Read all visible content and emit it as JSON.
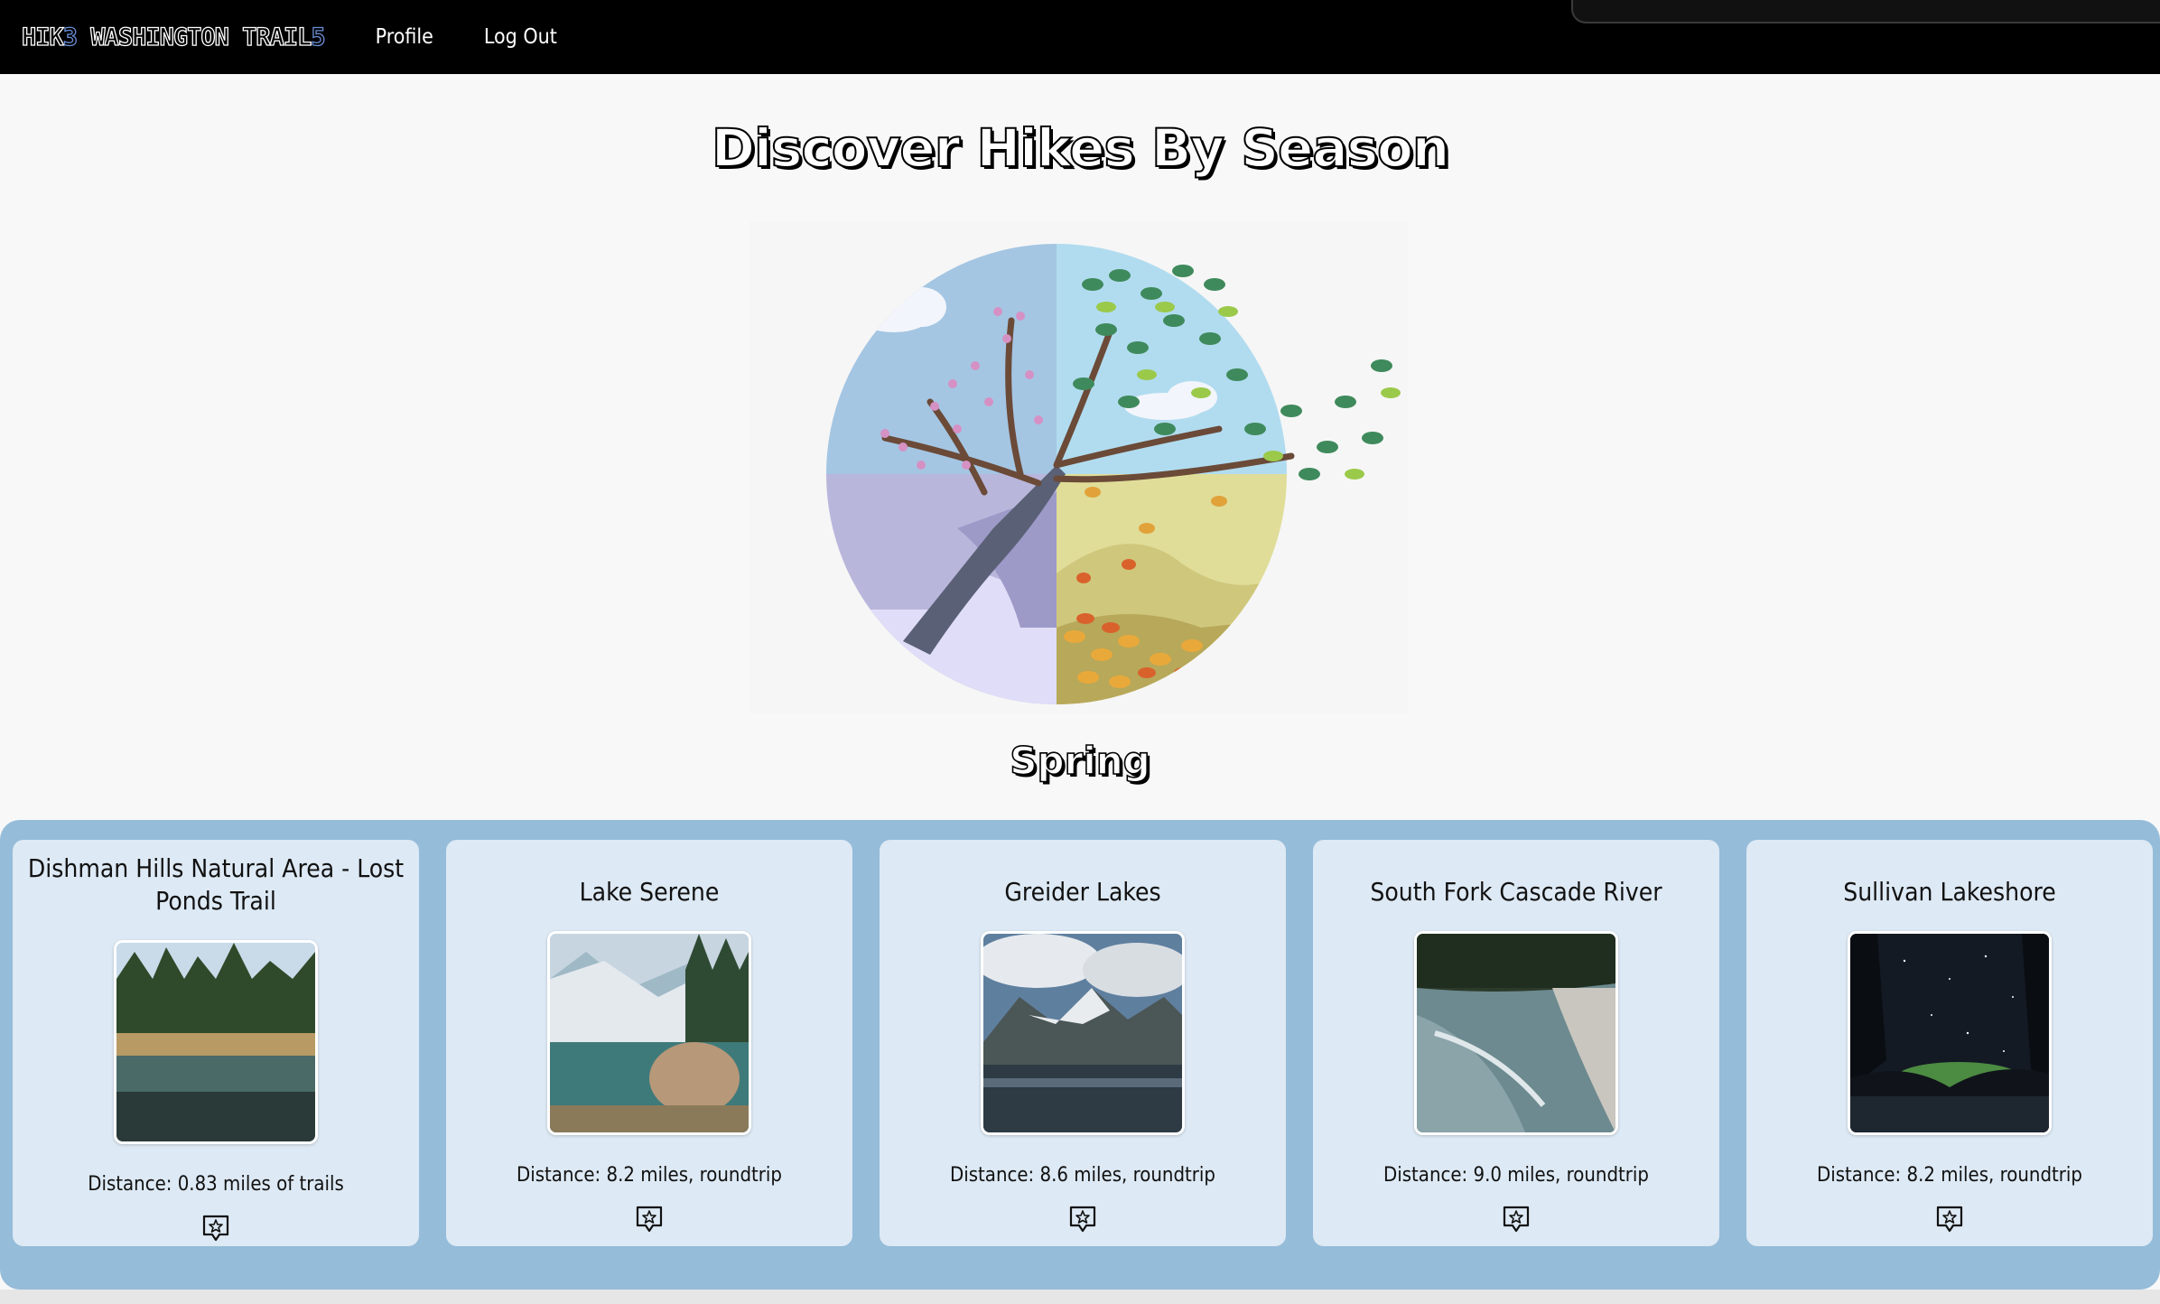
{
  "navbar": {
    "brand_pre": "HIK",
    "brand_e": "3",
    "brand_mid": " WASHINGTON TRAIL",
    "brand_s": "5",
    "links": [
      "Profile",
      "Log Out"
    ]
  },
  "page": {
    "title": "Discover Hikes By Season",
    "selected_season": "Spring"
  },
  "trails": [
    {
      "name": "Dishman Hills Natural Area - Lost Ponds Trail",
      "distance": "Distance: 0.83 miles of trails"
    },
    {
      "name": "Lake Serene",
      "distance": "Distance: 8.2 miles, roundtrip"
    },
    {
      "name": "Greider Lakes",
      "distance": "Distance: 8.6 miles, roundtrip"
    },
    {
      "name": "South Fork Cascade River",
      "distance": "Distance: 9.0 miles, roundtrip"
    },
    {
      "name": "Sullivan Lakeshore",
      "distance": "Distance: 8.2 miles, roundtrip"
    }
  ],
  "icons": {
    "favorite": "star-badge-icon"
  },
  "colors": {
    "navbar": "#000000",
    "strip": "#95bcd9",
    "card": "#dde9f4"
  }
}
